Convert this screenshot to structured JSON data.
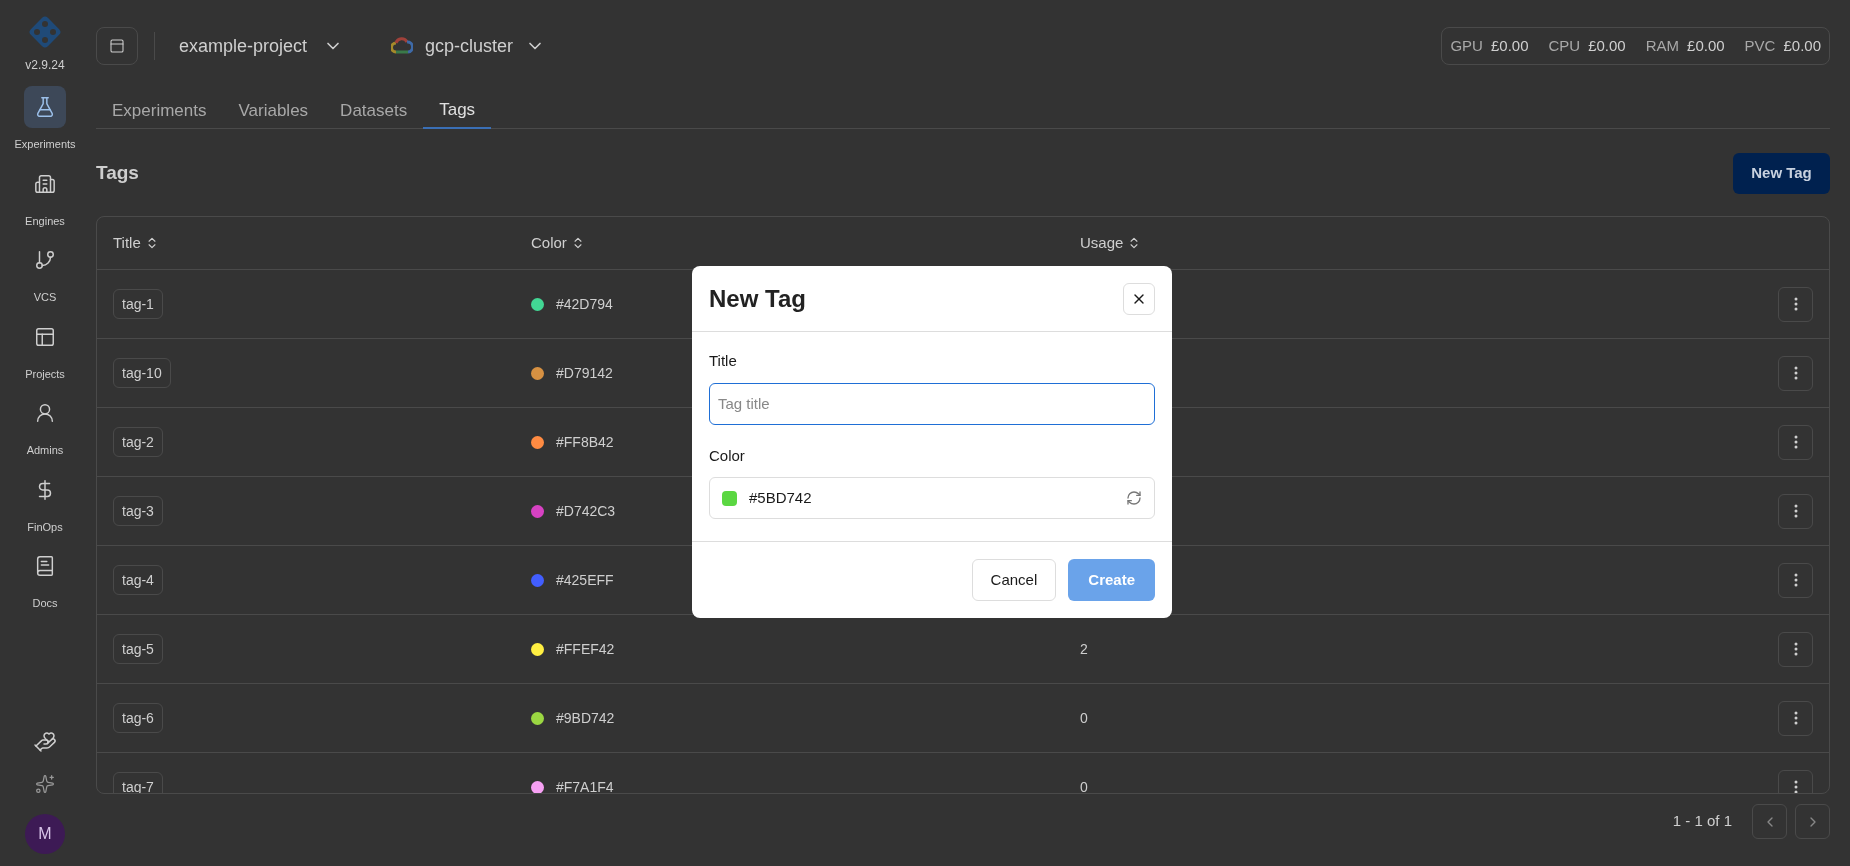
{
  "sidebar": {
    "version": "v2.9.24",
    "items": [
      {
        "kind": "flask",
        "label": "Experiments",
        "selected": true
      },
      {
        "kind": "building",
        "label": "Engines",
        "selected": false
      },
      {
        "kind": "branch",
        "label": "VCS",
        "selected": false
      },
      {
        "kind": "layout",
        "label": "Projects",
        "selected": false
      },
      {
        "kind": "admin",
        "label": "Admins",
        "selected": false
      },
      {
        "kind": "dollar",
        "label": "FinOps",
        "selected": false
      },
      {
        "kind": "book",
        "label": "Docs",
        "selected": false
      }
    ],
    "avatar": "M"
  },
  "topbar": {
    "project": "example-project",
    "cluster": "gcp-cluster",
    "costs": [
      {
        "label": "GPU",
        "value": "£0.00"
      },
      {
        "label": "CPU",
        "value": "£0.00"
      },
      {
        "label": "RAM",
        "value": "£0.00"
      },
      {
        "label": "PVC",
        "value": "£0.00"
      }
    ]
  },
  "tabs": [
    {
      "label": "Experiments",
      "selected": false
    },
    {
      "label": "Variables",
      "selected": false
    },
    {
      "label": "Datasets",
      "selected": false
    },
    {
      "label": "Tags",
      "selected": true
    }
  ],
  "page": {
    "title": "Tags",
    "new_button": "New Tag"
  },
  "table": {
    "columns": [
      "Title",
      "Color",
      "Usage"
    ],
    "rows": [
      {
        "title": "tag-1",
        "color": "#42D794",
        "color_text": "#42D794"
      },
      {
        "title": "tag-10",
        "color": "#D79142",
        "color_text": "#D79142"
      },
      {
        "title": "tag-2",
        "color": "#FF8B42",
        "color_text": "#FF8B42"
      },
      {
        "title": "tag-3",
        "color": "#D742C3",
        "color_text": "#D742C3"
      },
      {
        "title": "tag-4",
        "color": "#425EFF",
        "color_text": "#425EFF"
      },
      {
        "title": "tag-5",
        "color": "#FFEF42",
        "color_text": "#FFEF42",
        "usage": "2"
      },
      {
        "title": "tag-6",
        "color": "#9BD742",
        "color_text": "#9BD742",
        "usage": "0"
      },
      {
        "title": "tag-7",
        "color": "#F7A1F4",
        "color_text": "#F7A1F4",
        "usage": "0"
      }
    ]
  },
  "pagination": {
    "range": "1 - 1 of 1"
  },
  "dialog": {
    "title": "New Tag",
    "title_label": "Title",
    "title_placeholder": "Tag title",
    "color_label": "Color",
    "color_value": "#5BD742",
    "color": "#5BD742",
    "cancel": "Cancel",
    "create": "Create",
    "create_disabled": true
  }
}
